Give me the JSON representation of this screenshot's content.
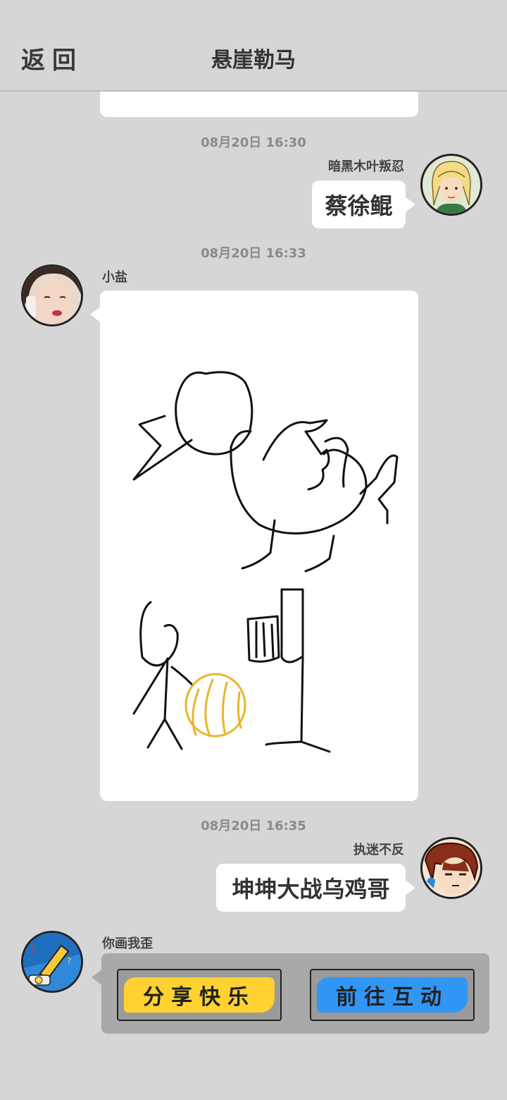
{
  "header": {
    "back_label": "返回",
    "title": "悬崖勒马"
  },
  "messages": [
    {
      "time": "08月20日  16:30",
      "sender": "暗黑木叶叛忍",
      "text": "蔡徐鲲"
    },
    {
      "time": "08月20日  16:33",
      "sender": "小盐"
    },
    {
      "time": "08月20日  16:35",
      "sender": "执迷不反",
      "text": "坤坤大战乌鸡哥"
    },
    {
      "sender": "你画我歪",
      "buttons": [
        "分享快乐",
        "前往互动"
      ]
    }
  ],
  "colors": {
    "background": "#d6d6d6",
    "bubble": "#ffffff",
    "share_button": "#ffd231",
    "goto_button": "#3296f5",
    "ball_stroke": "#e8b62c"
  },
  "icons": {
    "avatar1": "blonde-ninja-avatar",
    "avatar2": "girl-selfie-avatar",
    "avatar3": "brown-hair-boy-avatar",
    "avatar4": "pencil-game-avatar"
  }
}
